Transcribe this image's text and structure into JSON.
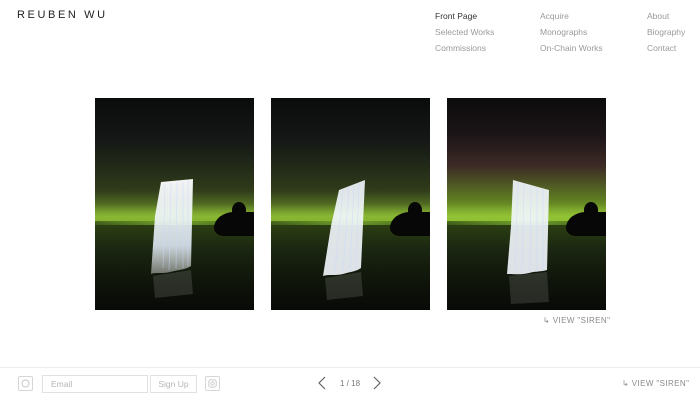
{
  "site": {
    "logo": "REUBEN WU"
  },
  "nav": {
    "col1": [
      "Front Page",
      "Selected Works",
      "Commissions"
    ],
    "col2": [
      "Acquire",
      "Monographs",
      "On-Chain Works"
    ],
    "col3": [
      "About",
      "Biography",
      "Contact"
    ],
    "active": "Front Page"
  },
  "gallery": {
    "images": [
      {
        "name": "siren-photo-1",
        "tone": "green"
      },
      {
        "name": "siren-photo-2",
        "tone": "green"
      },
      {
        "name": "siren-photo-3",
        "tone": "pink-green"
      }
    ],
    "view_link": "↳ VIEW \"SIREN\""
  },
  "footer": {
    "email_placeholder": "Email",
    "signup_label": "Sign Up",
    "pagination": "1 / 18",
    "view_link": "↳ VIEW \"SIREN\""
  },
  "colors": {
    "text_active": "#333333",
    "text_muted": "#9a9a9a",
    "border": "#e1e1e1"
  }
}
